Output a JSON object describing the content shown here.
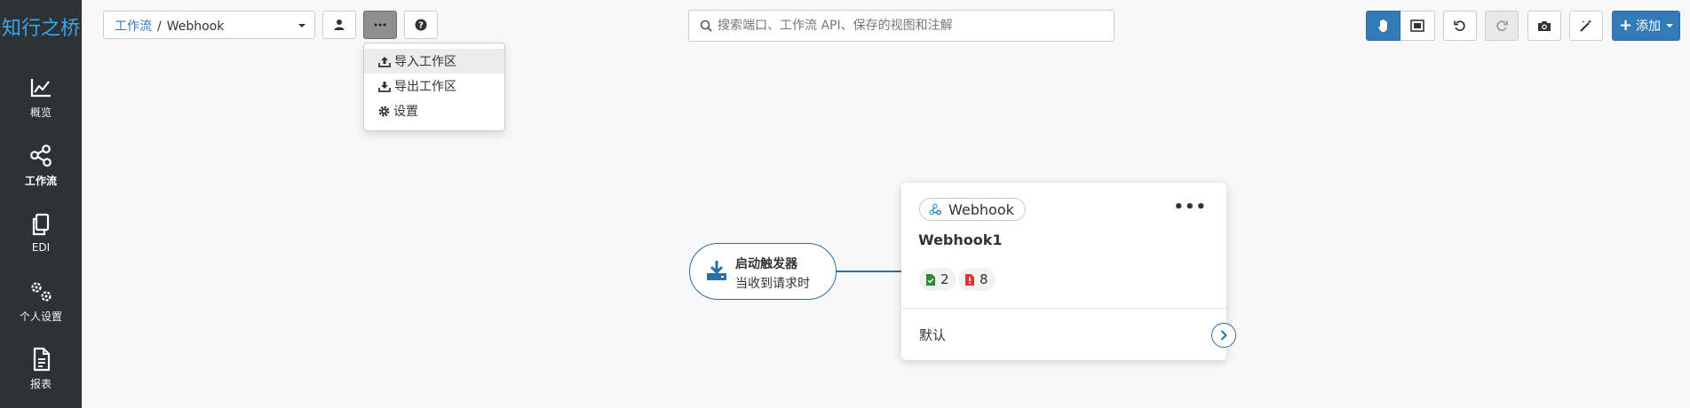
{
  "app": {
    "logo_text": "知行之桥"
  },
  "sidebar": {
    "items": [
      {
        "label": "概览",
        "icon": "chart-line-icon"
      },
      {
        "label": "工作流",
        "icon": "share-nodes-icon",
        "active": true
      },
      {
        "label": "EDI",
        "icon": "copy-icon"
      },
      {
        "label": "个人设置",
        "icon": "gears-icon"
      },
      {
        "label": "报表",
        "icon": "file-text-icon"
      }
    ]
  },
  "toolbar": {
    "breadcrumb": {
      "parent": "工作流",
      "separator": "/",
      "current": "Webhook"
    },
    "search_placeholder": "搜索端口、工作流 API、保存的视图和注解",
    "add_label": "添加"
  },
  "more_menu": {
    "items": [
      {
        "label": "导入工作区",
        "icon": "upload-icon"
      },
      {
        "label": "导出工作区",
        "icon": "download-icon"
      },
      {
        "label": "设置",
        "icon": "gear-icon"
      }
    ]
  },
  "canvas": {
    "trigger": {
      "title": "启动触发器",
      "subtitle": "当收到请求时"
    },
    "node": {
      "type_label": "Webhook",
      "name": "Webhook1",
      "success_count": "2",
      "error_count": "8",
      "footer_label": "默认"
    }
  },
  "colors": {
    "sidebar_bg": "#2d3236",
    "accent": "#337ab7",
    "logo": "#3ea6e6",
    "success": "#2e8b3a",
    "error": "#d9363e"
  }
}
